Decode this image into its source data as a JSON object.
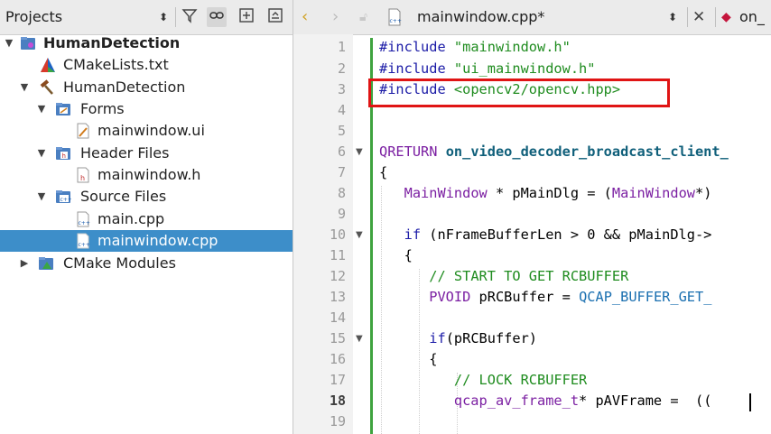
{
  "projects_panel": {
    "title": "Projects",
    "tree": [
      {
        "label": "HumanDetection",
        "bold": true,
        "expanded": true,
        "icon": "project-icon",
        "depth": 0
      },
      {
        "label": "CMakeLists.txt",
        "icon": "cmake-file-icon",
        "depth": 1
      },
      {
        "label": "HumanDetection",
        "expanded": true,
        "icon": "hammer-icon",
        "depth": 1
      },
      {
        "label": "Forms",
        "expanded": true,
        "icon": "forms-folder-icon",
        "depth": 2
      },
      {
        "label": "mainwindow.ui",
        "icon": "ui-file-icon",
        "depth": 3
      },
      {
        "label": "Header Files",
        "expanded": true,
        "icon": "header-folder-icon",
        "depth": 2
      },
      {
        "label": "mainwindow.h",
        "icon": "header-file-icon",
        "depth": 3
      },
      {
        "label": "Source Files",
        "expanded": true,
        "icon": "source-folder-icon",
        "depth": 2
      },
      {
        "label": "main.cpp",
        "icon": "cpp-file-icon",
        "depth": 3
      },
      {
        "label": "mainwindow.cpp",
        "icon": "cpp-file-icon",
        "depth": 3,
        "selected": true
      },
      {
        "label": "CMake Modules",
        "expanded": false,
        "icon": "cmake-modules-icon",
        "depth": 1
      }
    ]
  },
  "editor": {
    "file_name": "mainwindow.cpp*",
    "next_tab": "on_",
    "current_line": 18,
    "line_numbers": [
      "1",
      "2",
      "3",
      "4",
      "5",
      "6",
      "7",
      "8",
      "9",
      "10",
      "11",
      "12",
      "13",
      "14",
      "15",
      "16",
      "17",
      "18",
      "19"
    ],
    "code": {
      "l1_pp": "#include",
      "l1_str": "\"mainwindow.h\"",
      "l2_pp": "#include",
      "l2_str": "\"ui_mainwindow.h\"",
      "l3_pp": "#include",
      "l3_str": "<opencv2/opencv.hpp>",
      "l6_type": "QRETURN",
      "l6_fn": "on_video_decoder_broadcast_client_",
      "l7": "{",
      "l8_type": "MainWindow",
      "l8_rest": " * pMainDlg = (",
      "l8_type2": "MainWindow",
      "l8_rest2": "*)",
      "l10_kw": "if",
      "l10_rest": " (nFrameBufferLen > 0 && pMainDlg->",
      "l11": "{",
      "l12_cm": "// START TO GET RCBUFFER",
      "l13_type": "PVOID",
      "l13_rest": " pRCBuffer = ",
      "l13_macro": "QCAP_BUFFER_GET_",
      "l15_kw": "if",
      "l15_rest": "(pRCBuffer)",
      "l16": "{",
      "l17_cm": "// LOCK RCBUFFER",
      "l18_type": "qcap_av_frame_t",
      "l18_rest": "* pAVFrame = ",
      "l18_tail": " (("
    }
  },
  "colors": {
    "selection": "#3d8ec9",
    "highlight_box": "#e01414",
    "modified_bar": "#3fa33f"
  }
}
